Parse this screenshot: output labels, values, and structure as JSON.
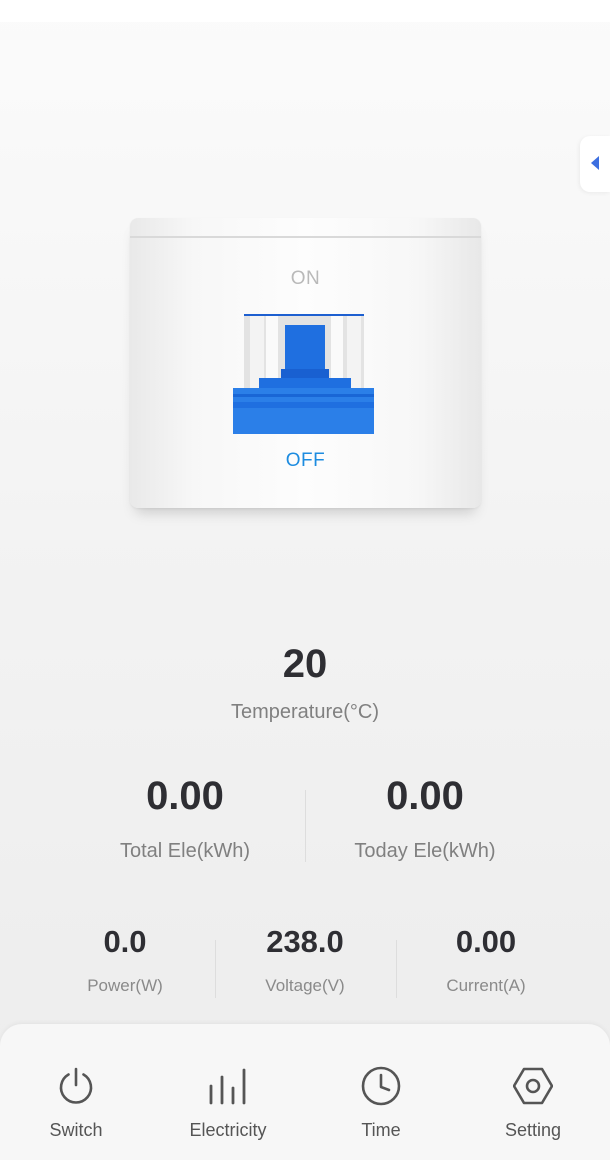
{
  "breaker": {
    "on_label": "ON",
    "off_label": "OFF",
    "state": "off",
    "accent_color": "#1d75e6"
  },
  "temperature": {
    "value": "20",
    "label": "Temperature(°C)"
  },
  "energy": [
    {
      "value": "0.00",
      "label": "Total Ele(kWh)"
    },
    {
      "value": "0.00",
      "label": "Today Ele(kWh)"
    }
  ],
  "metrics": [
    {
      "value": "0.0",
      "label": "Power(W)"
    },
    {
      "value": "238.0",
      "label": "Voltage(V)"
    },
    {
      "value": "0.00",
      "label": "Current(A)"
    }
  ],
  "tabs": [
    {
      "label": "Switch",
      "icon": "power-icon"
    },
    {
      "label": "Electricity",
      "icon": "bar-chart-icon"
    },
    {
      "label": "Time",
      "icon": "clock-icon"
    },
    {
      "label": "Setting",
      "icon": "hexagon-gear-icon"
    }
  ],
  "side_handle_icon": "chevron-left-icon"
}
